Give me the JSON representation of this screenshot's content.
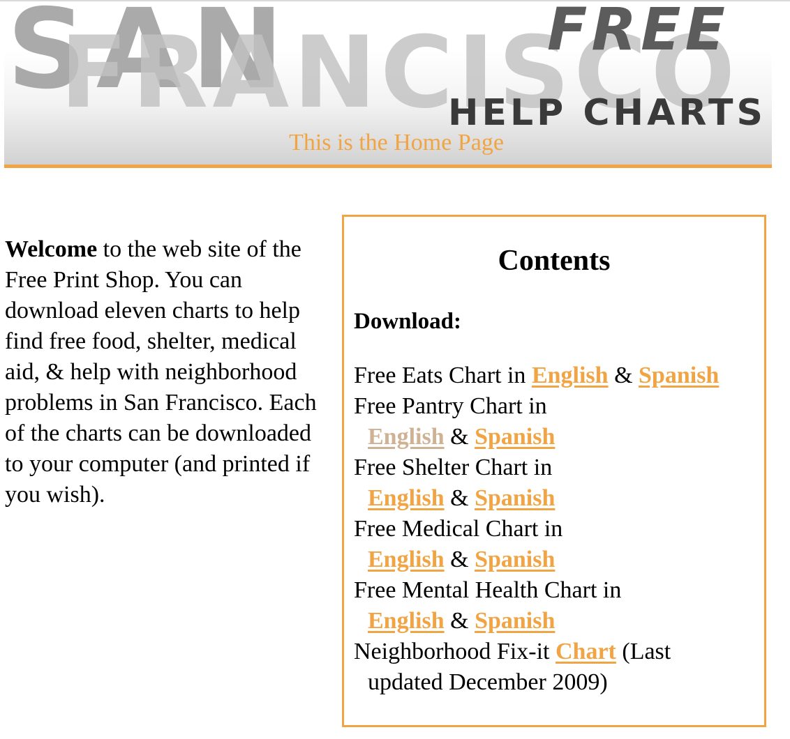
{
  "banner": {
    "word1": "SAN",
    "word2": "FRANCISCO",
    "free": "FREE",
    "help_charts": "HELP CHARTS",
    "home_text": "This is the Home Page"
  },
  "welcome": {
    "bold": "Welcome",
    "text": " to the web site of the Free Print Shop. You can download eleven charts to help find free food, shelter, medical aid, & help with neighborhood problems in San Francisco. Each of the charts can be downloaded to your computer (and printed if you wish)."
  },
  "contents": {
    "title": "Contents",
    "download_label": "Download:",
    "amp": "&",
    "charts": [
      {
        "label": "Free Eats Chart in",
        "english": "English",
        "spanish": "Spanish"
      },
      {
        "label": "Free Pantry Chart in",
        "english": "English",
        "spanish": "Spanish"
      },
      {
        "label": "Free Shelter Chart in",
        "english": "English",
        "spanish": "Spanish"
      },
      {
        "label": "Free Medical Chart in",
        "english": "English",
        "spanish": "Spanish"
      },
      {
        "label": "Free Mental Health Chart in",
        "english": "English",
        "spanish": "Spanish"
      }
    ],
    "fixit": {
      "prefix": "Neighborhood Fix-it",
      "link": "Chart",
      "suffix_line1": "(Last",
      "suffix_line2": "updated December 2009)"
    }
  },
  "colors": {
    "accent": "#f1a443",
    "visited_link": "#cfb293"
  }
}
